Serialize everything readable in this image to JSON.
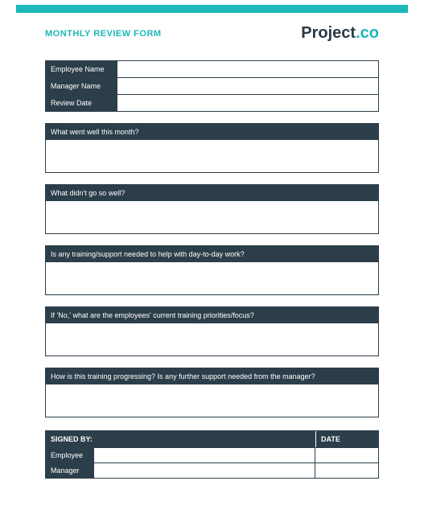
{
  "header": {
    "title": "MONTHLY REVIEW FORM",
    "brand_main": "Project",
    "brand_suffix": ".co"
  },
  "info": {
    "rows": [
      {
        "label": "Employee Name",
        "value": ""
      },
      {
        "label": "Manager Name",
        "value": ""
      },
      {
        "label": "Review Date",
        "value": ""
      }
    ]
  },
  "sections": [
    {
      "question": "What went well this month?",
      "answer": ""
    },
    {
      "question": "What didn't go so well?",
      "answer": ""
    },
    {
      "question": "Is any training/support needed to help with day-to-day work?",
      "answer": ""
    },
    {
      "question": "If 'No,' what are the employees' current training priorities/focus?",
      "answer": ""
    },
    {
      "question": "How is this training progressing? Is any further support needed from the manager?",
      "answer": ""
    }
  ],
  "signoff": {
    "header_left": "SIGNED BY:",
    "header_right": "DATE",
    "rows": [
      {
        "label": "Employee",
        "signature": "",
        "date": ""
      },
      {
        "label": "Manager",
        "signature": "",
        "date": ""
      }
    ]
  }
}
